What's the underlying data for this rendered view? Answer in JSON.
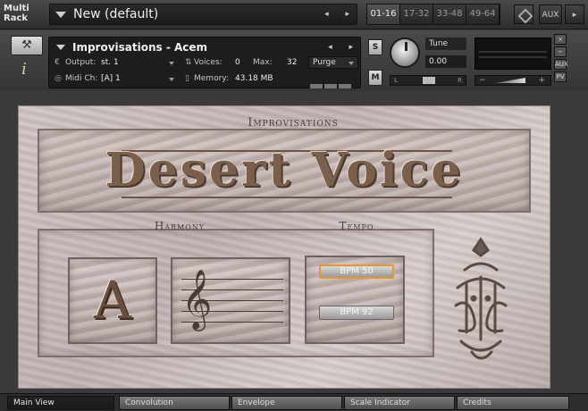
{
  "multirack": {
    "label_line1": "Multi",
    "label_line2": "Rack",
    "title": "New (default)",
    "arrows": "◂ ▸",
    "pages": [
      "01-16",
      "17-32",
      "33-48",
      "49-64"
    ],
    "aux_label": "AUX",
    "aux_arrow": "▸"
  },
  "instrument": {
    "title": "Improvisations - Acem",
    "arrows": "◂ ▸",
    "output_label": "Output:",
    "output_value": "st. 1",
    "voices_label": "Voices:",
    "voices_value": "0",
    "max_label": "Max:",
    "max_value": "32",
    "purge_label": "Purge",
    "midi_label": "Midi Ch:",
    "midi_value": "[A]  1",
    "memory_label": "Memory:",
    "memory_value": "43.18 MB",
    "solo_label": "S",
    "mute_label": "M",
    "tune_label": "Tune",
    "tune_value": "0.00",
    "pan_left": "L",
    "pan_right": "R",
    "vol_minus": "−",
    "vol_plus": "+",
    "side_buttons": [
      "×",
      "−",
      "AUX",
      "PV"
    ]
  },
  "panel": {
    "header": "Improvisations",
    "logo": "Desert Voice",
    "harmony_label": "Harmony",
    "tempo_label": "Tempo",
    "note": "A",
    "clef": "𝄞",
    "bpm_buttons": [
      "BPM 50",
      "BPM 92"
    ],
    "active_bpm": "BPM 50"
  },
  "bottom_tabs": [
    "Main View",
    "Convolution",
    "Envelope",
    "Scale Indicator",
    "Credits"
  ],
  "colors": {
    "accent_orange": "#e19a2e",
    "panel_sand": "#c8bcba",
    "text_brown": "#4a3e3a"
  },
  "icons": {
    "wrench": "wrench-icon",
    "info": "info-icon",
    "output": "output-icon",
    "midi": "midi-icon",
    "voices": "voices-icon",
    "memory": "memory-icon"
  }
}
